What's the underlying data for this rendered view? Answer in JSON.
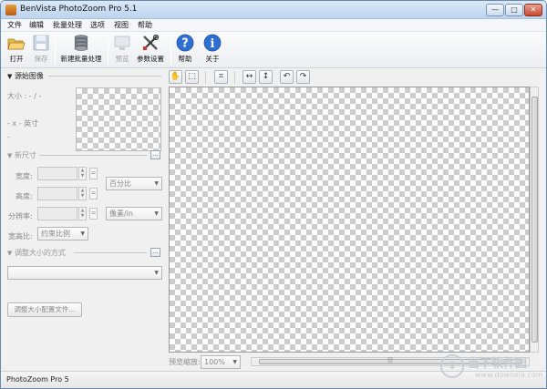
{
  "window": {
    "title": "BenVista PhotoZoom Pro 5.1",
    "controls": {
      "minimize": "—",
      "maximize": "□",
      "close": "✕"
    }
  },
  "menu": [
    "文件",
    "编辑",
    "批量处理",
    "选项",
    "视图",
    "帮助"
  ],
  "toolbar": {
    "open": "打开",
    "save": "保存",
    "batch": "新建批量处理",
    "preview": "预览",
    "settings": "参数设置",
    "help": "帮助",
    "about": "关于"
  },
  "source_image": {
    "header": "源始图像",
    "size_label": "大小 : - / -",
    "dims_label": "- x - 英寸",
    "dash": "-"
  },
  "new_size": {
    "header": "新尺寸",
    "more": "...",
    "width_label": "宽度:",
    "height_label": "高度:",
    "resolution_label": "分辨率:",
    "aspect_label": "宽高比:",
    "unit_select": "百分比",
    "res_unit_select": "像素/in",
    "aspect_select": "约束比例",
    "spin_up": "▲",
    "spin_down": "▼",
    "eq": "="
  },
  "resize_method": {
    "header": "调整大小的方式",
    "more": "...",
    "select": "",
    "preset_button": "调整大小配置文件..."
  },
  "view_tools": [
    "✋",
    "⬚",
    "⌗",
    "↔",
    "↕",
    "↶",
    "↷"
  ],
  "zoom": {
    "label": "预览缩放:",
    "value": "100%"
  },
  "scrollbar": {
    "grip": "|||"
  },
  "arrow": "▼",
  "status": {
    "text": "PhotoZoom Pro 5"
  },
  "watermark": {
    "cn": "当下软件园",
    "en": "www.downxia.com",
    "mark": "↓"
  }
}
